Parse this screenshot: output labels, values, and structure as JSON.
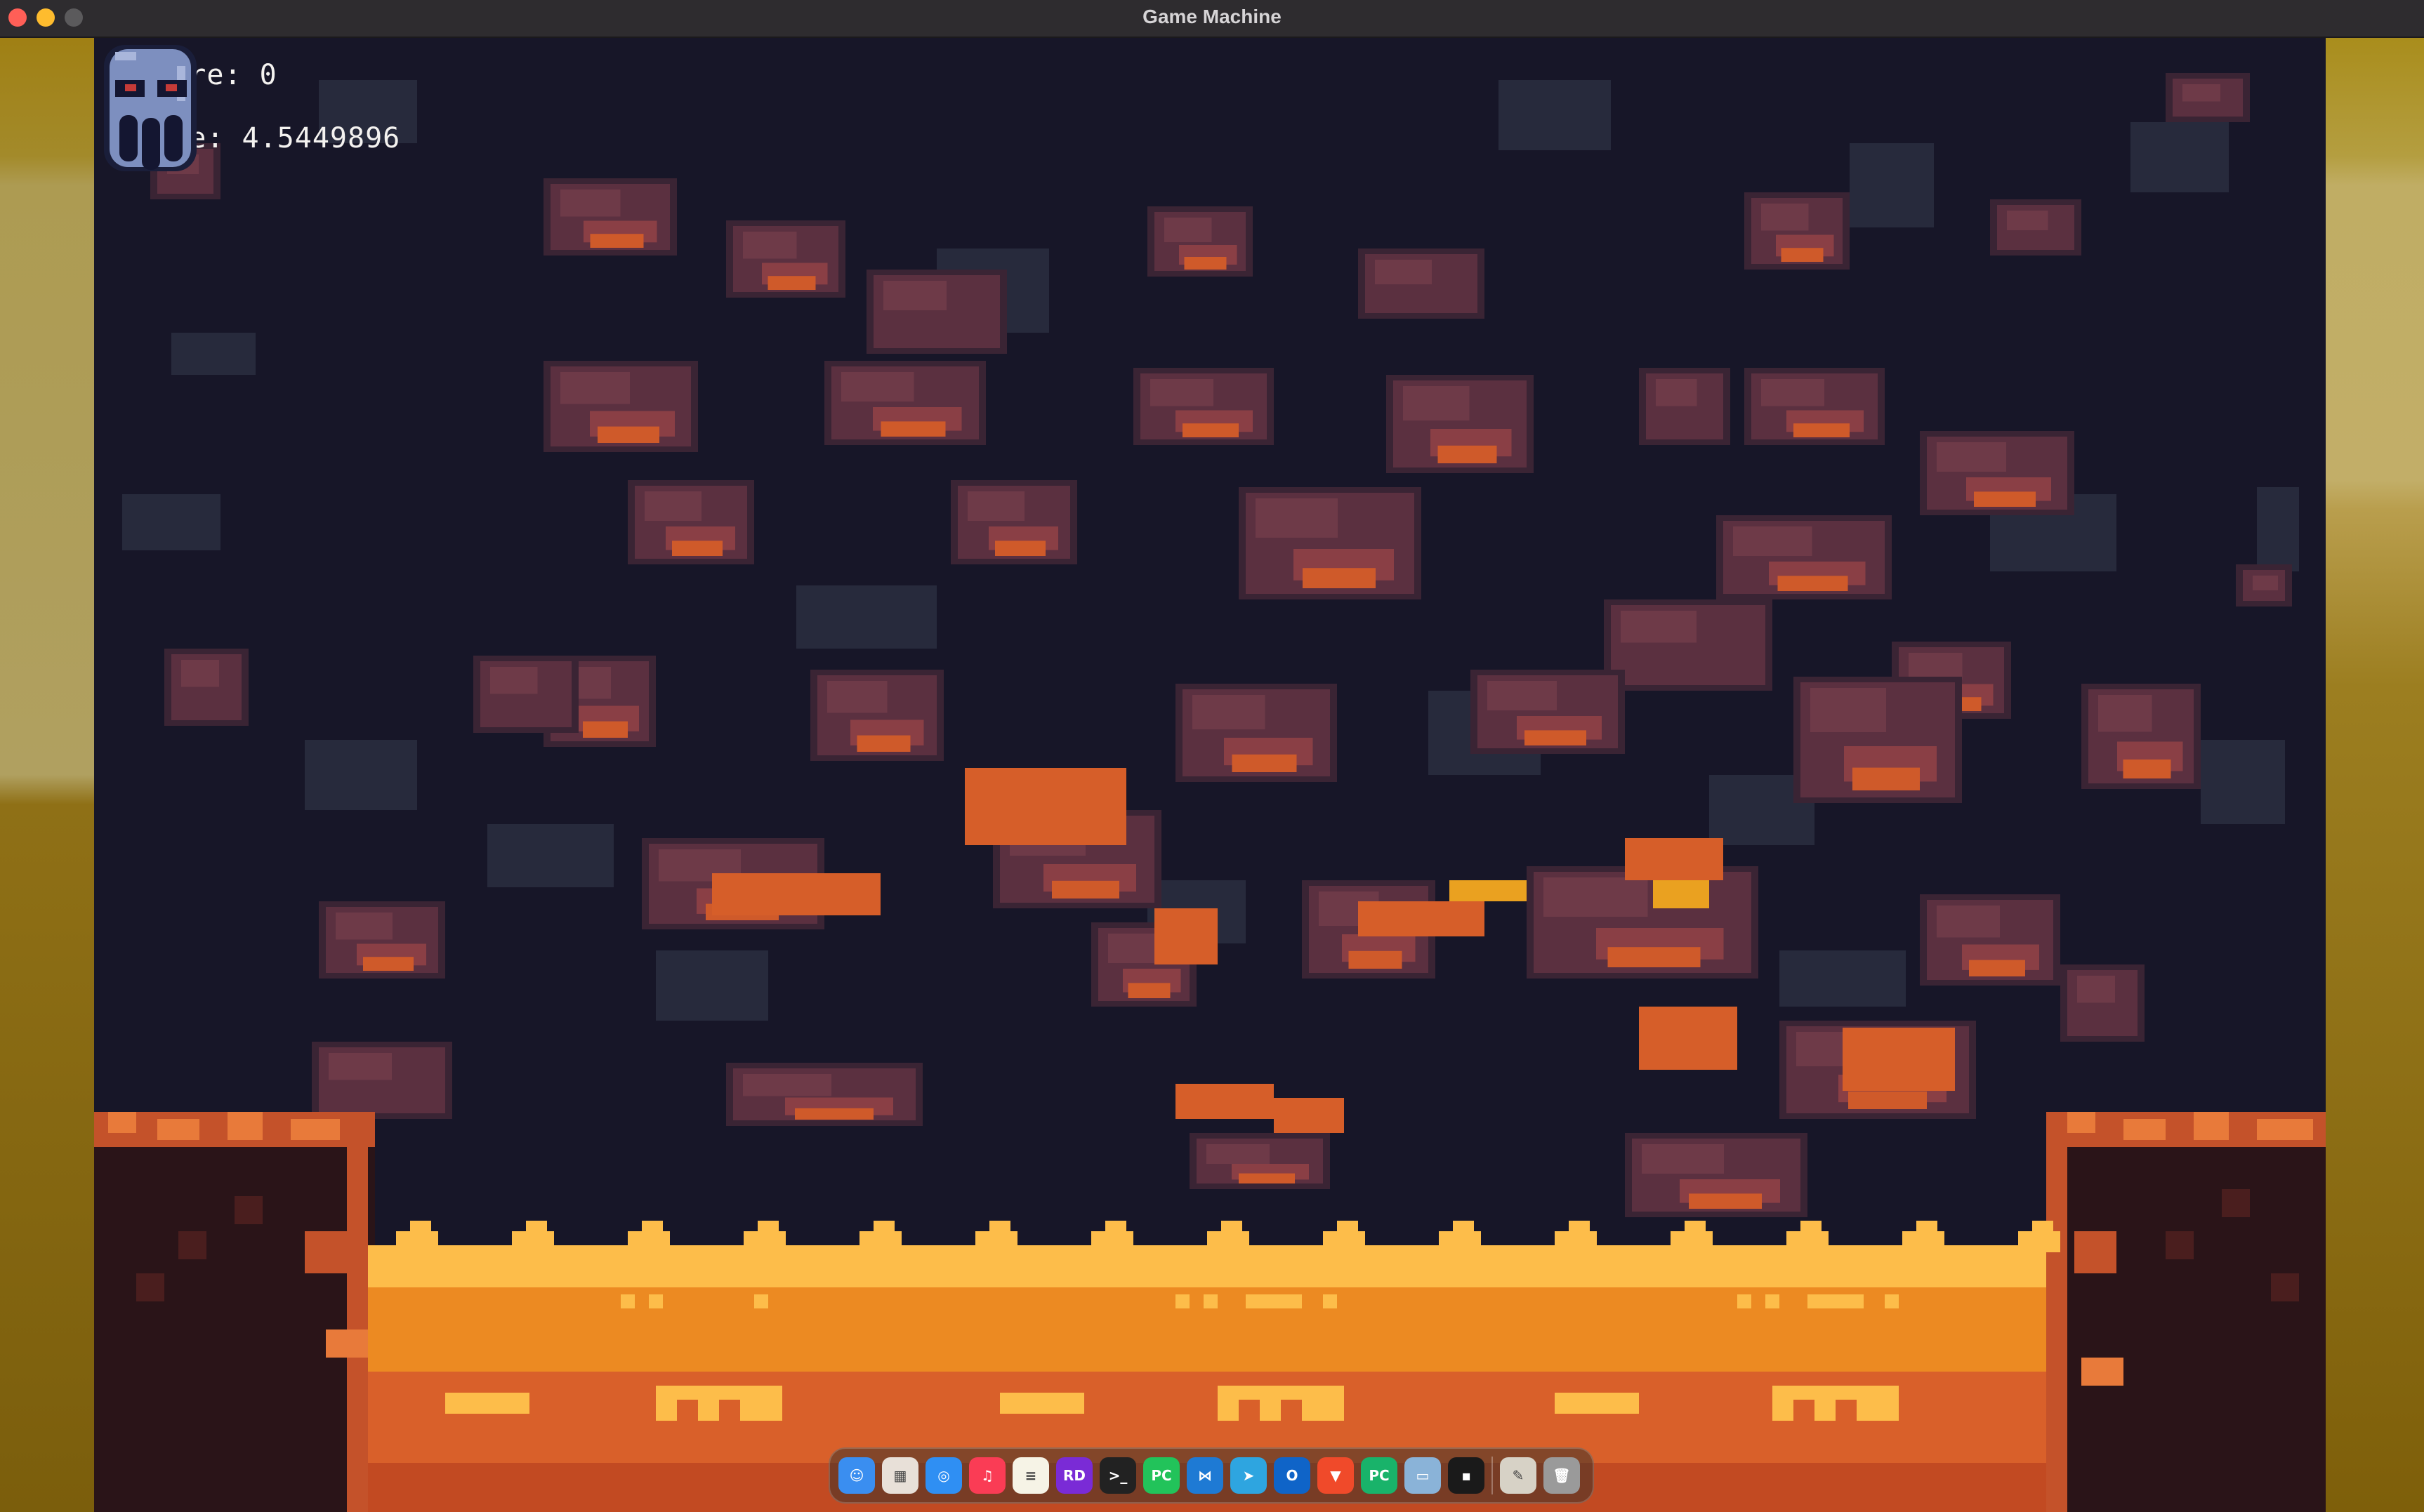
{
  "window": {
    "title": "Game Machine"
  },
  "hud": {
    "score": "Score: 0",
    "time": "Time: 4.5449896"
  },
  "dock": {
    "apps": [
      {
        "name": "finder-icon",
        "color": "#3a8ef0",
        "glyph": "☺"
      },
      {
        "name": "launchpad-icon",
        "color": "#e8e0d8",
        "glyph": "▦"
      },
      {
        "name": "safari-icon",
        "color": "#2f8ff3",
        "glyph": "◎"
      },
      {
        "name": "music-icon",
        "color": "#fa3c55",
        "glyph": "♫"
      },
      {
        "name": "notes-icon",
        "color": "#f6f3e6",
        "glyph": "≡"
      },
      {
        "name": "rider-icon",
        "color": "#7a2bd6",
        "glyph": "RD"
      },
      {
        "name": "terminal-icon",
        "color": "#222222",
        "glyph": ">_"
      },
      {
        "name": "pycharm-icon",
        "color": "#22c35a",
        "glyph": "PC"
      },
      {
        "name": "vscode-icon",
        "color": "#1e7ad4",
        "glyph": "⋈"
      },
      {
        "name": "telegram-icon",
        "color": "#2ea5e0",
        "glyph": "➤"
      },
      {
        "name": "outlook-icon",
        "color": "#0f64c8",
        "glyph": "O"
      },
      {
        "name": "brave-icon",
        "color": "#f04a2a",
        "glyph": "▼"
      },
      {
        "name": "pycharm-ce-icon",
        "color": "#19b36a",
        "glyph": "PC"
      },
      {
        "name": "preview-icon",
        "color": "#8ab3d8",
        "glyph": "▭"
      },
      {
        "name": "console-icon",
        "color": "#1a1a1a",
        "glyph": "▪"
      },
      {
        "name": "separator"
      },
      {
        "name": "script-editor-icon",
        "color": "#d7d2c6",
        "glyph": "✎"
      },
      {
        "name": "trash-icon",
        "color": "#9a9a9a",
        "glyph": "🗑"
      }
    ]
  }
}
